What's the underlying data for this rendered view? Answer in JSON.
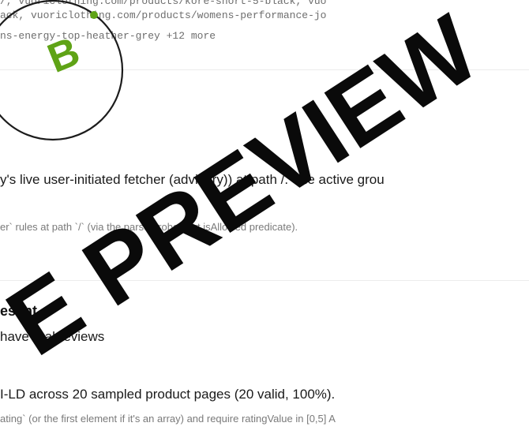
{
  "urls": {
    "line1": "/, vuoriclothing.com/products/kore-short-5-black, vuo",
    "line2": "ack, vuoriclothing.com/products/womens-performance-jo",
    "line3": "ns-energy-top-heather-grey +12 more"
  },
  "grade": {
    "letter": "B",
    "color": "#5fa316"
  },
  "robots": {
    "summary": "y's live user-initiated fetcher (advisory)) at path /. The active grou",
    "detail": "er` rules at path `/` (via the parsed robots.txt isAllowed predicate)."
  },
  "reviews": {
    "title": "esent",
    "subtitle": "have real reviews",
    "summary": "I-LD across 20 sampled product pages (20 valid, 100%).",
    "detail": "ating` (or the first element if it's an array) and require ratingValue in [0,5] A"
  },
  "watermark": {
    "text": "E PREVIEW",
    "color": "#0a0a0a"
  }
}
